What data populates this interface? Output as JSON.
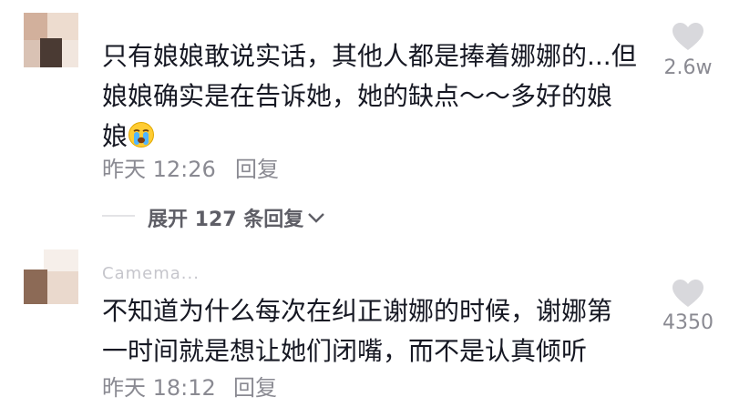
{
  "comments": [
    {
      "username": "",
      "text_line1": "只有娘娘敢说实话，其他人都是捧着娜娜的...但",
      "text_line2": "娘娘确实是在告诉她，她的缺点～～多好的娘",
      "text_line3": "娘",
      "emoji": "crying-face",
      "time": "昨天 12:26",
      "reply_label": "回复",
      "likes": "2.6w",
      "expand_label": "展开 127 条回复"
    },
    {
      "username": "Camema...",
      "text_line1": "不知道为什么每次在纠正谢娜的时候，谢娜第",
      "text_line2": "一时间就是想让她们闭嘴，而不是认真倾听",
      "time": "昨天 18:12",
      "reply_label": "回复",
      "likes": "4350"
    }
  ],
  "colors": {
    "text": "#161823",
    "meta": "#8a8a92",
    "heart": "#d8d8dc"
  }
}
